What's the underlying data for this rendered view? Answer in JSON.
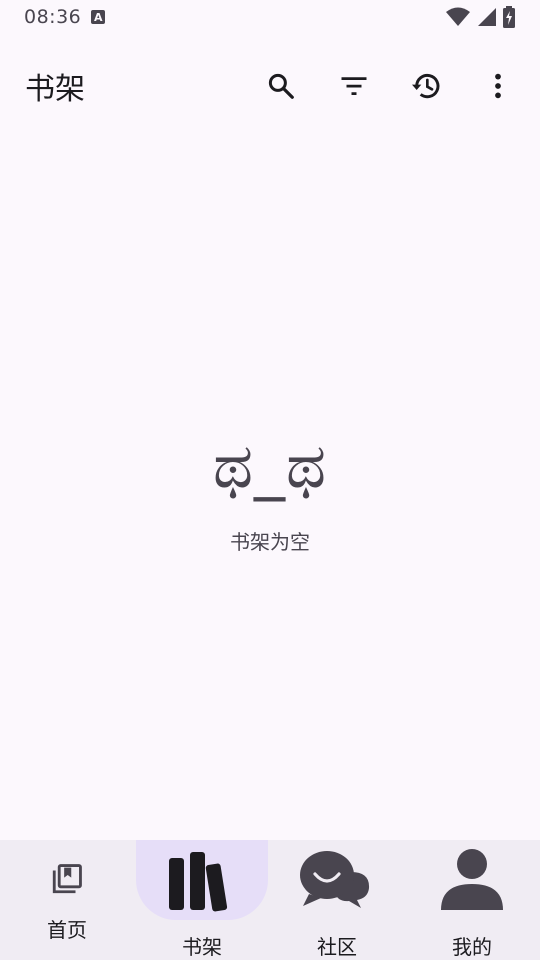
{
  "status_bar": {
    "time": "08:36",
    "notification_icon": "a-notification-icon",
    "icons": [
      "wifi-icon",
      "signal-icon",
      "battery-charging-icon"
    ]
  },
  "app_bar": {
    "title": "书架",
    "actions": [
      "search-icon",
      "filter-icon",
      "history-icon",
      "more-vert-icon"
    ]
  },
  "empty_state": {
    "emoticon": "ಥ_ಥ",
    "message": "书架为空"
  },
  "bottom_nav": {
    "selected": "书架",
    "items": [
      {
        "label": "首页",
        "icon": "library-books-icon"
      },
      {
        "label": "书架",
        "icon": "bookshelf-icon"
      },
      {
        "label": "社区",
        "icon": "chat-bubbles-icon"
      },
      {
        "label": "我的",
        "icon": "person-icon"
      }
    ]
  },
  "colors": {
    "background": "#fcf8fd",
    "nav_background": "#f0ecf3",
    "nav_indicator": "#e6def8",
    "icon": "#49454f",
    "text": "#1c1b1f"
  }
}
